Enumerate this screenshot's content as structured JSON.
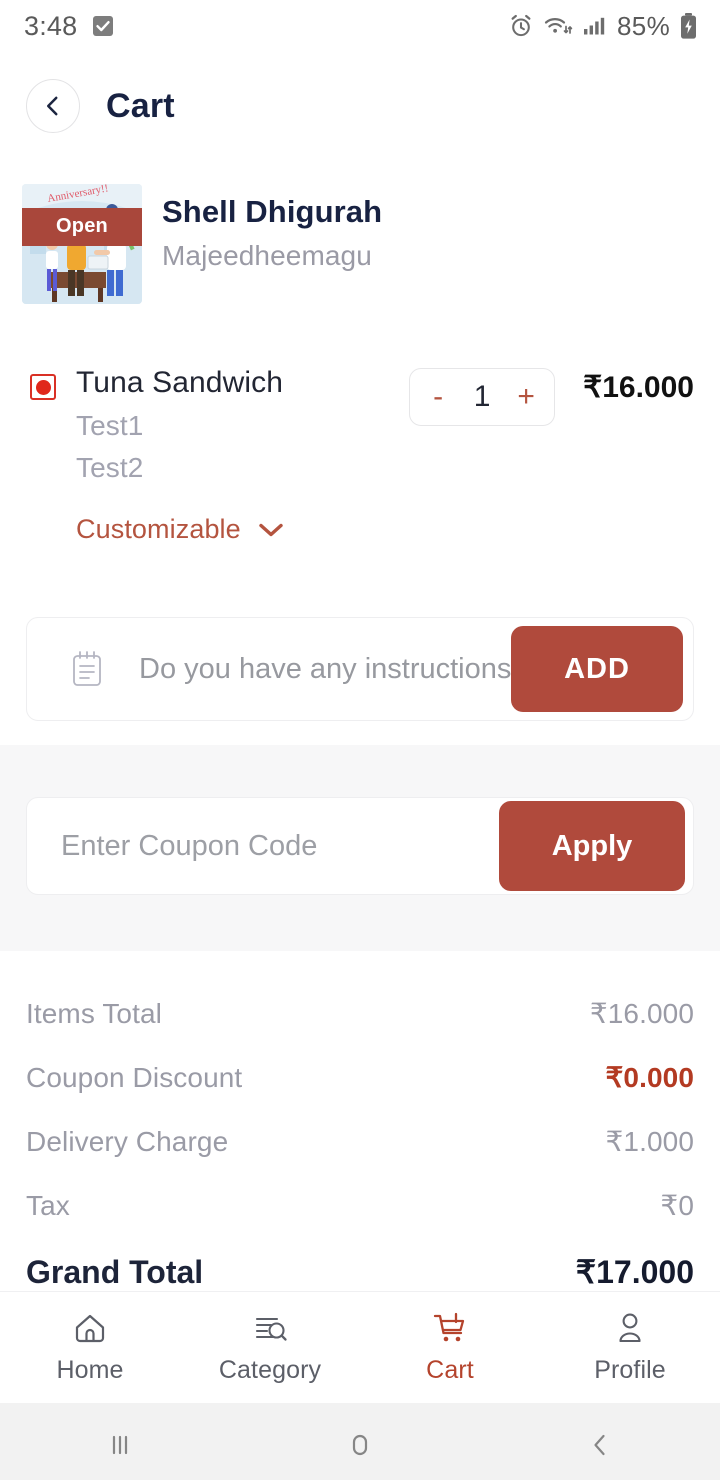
{
  "status_bar": {
    "time": "3:48",
    "battery_percent": "85%",
    "icons": [
      "checkbox-checked-icon",
      "alarm-icon",
      "wifi-icon",
      "signal-icon",
      "battery-charging-icon"
    ]
  },
  "header": {
    "title": "Cart",
    "back_icon": "chevron-left-icon"
  },
  "store": {
    "name": "Shell Dhigurah",
    "address": "Majeedheemagu",
    "status_badge": "Open",
    "thumbnail_alt": "anniversary-illustration"
  },
  "cart_item": {
    "diet_indicator": "non-veg-indicator",
    "name": "Tuna Sandwich",
    "options": [
      "Test1",
      "Test2"
    ],
    "customizable_label": "Customizable",
    "customizable_chevron": "chevron-down-icon",
    "decrement": "-",
    "increment": "+",
    "quantity": "1",
    "price": "₹16.000"
  },
  "instructions": {
    "icon": "notepad-icon",
    "placeholder": "Do you have any instructions?",
    "value": "",
    "add_label": "ADD"
  },
  "coupon": {
    "placeholder": "Enter Coupon Code",
    "value": "",
    "apply_label": "Apply"
  },
  "totals": {
    "rows": [
      {
        "label": "Items Total",
        "value": "₹16.000",
        "accent": false
      },
      {
        "label": "Coupon Discount",
        "value": "₹0.000",
        "accent": true
      },
      {
        "label": "Delivery Charge",
        "value": "₹1.000",
        "accent": false
      },
      {
        "label": "Tax",
        "value": "₹0",
        "accent": false
      }
    ],
    "grand_label": "Grand Total",
    "grand_value": "₹17.000"
  },
  "bottom_nav": {
    "items": [
      {
        "label": "Home",
        "icon": "home-icon",
        "active": false
      },
      {
        "label": "Category",
        "icon": "category-search-icon",
        "active": false
      },
      {
        "label": "Cart",
        "icon": "shopping-cart-icon",
        "active": true
      },
      {
        "label": "Profile",
        "icon": "person-icon",
        "active": false
      }
    ]
  },
  "system_nav": {
    "recents_icon": "recents-icon",
    "home_icon": "home-pill-icon",
    "back_icon": "system-back-icon"
  },
  "colors": {
    "accent": "#b04a3c",
    "title": "#182242",
    "muted": "#9a9ba6",
    "discount": "#b33a22"
  }
}
